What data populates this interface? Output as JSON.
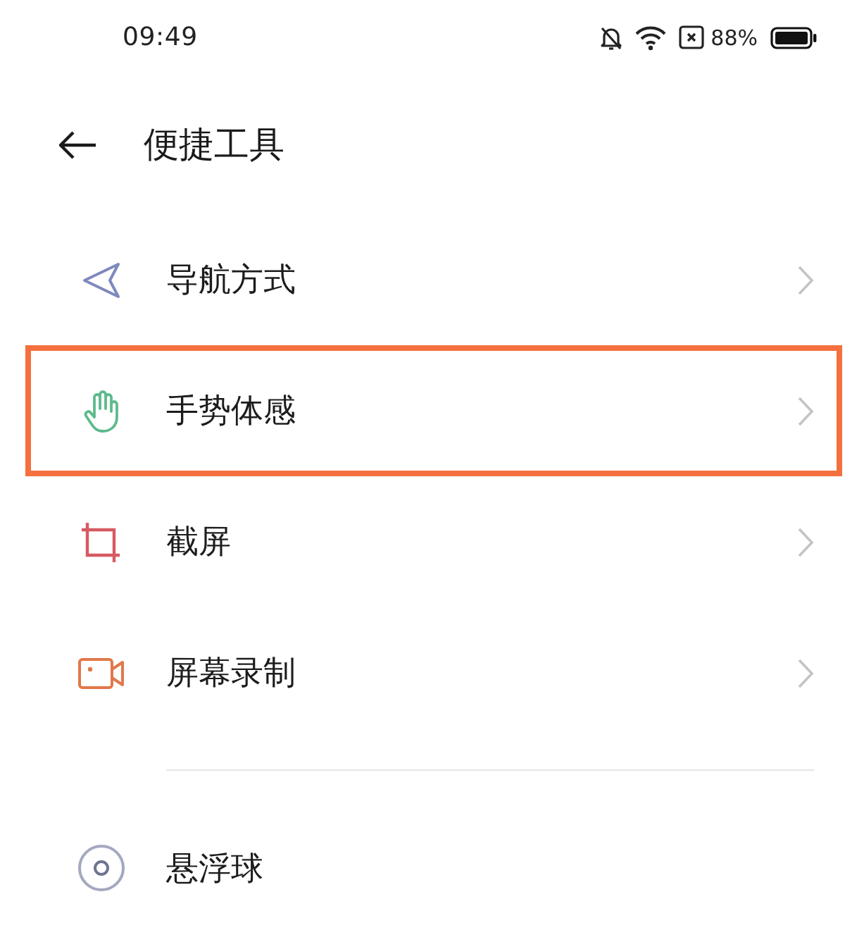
{
  "status_bar": {
    "time": "09:49",
    "battery_text": "88%"
  },
  "header": {
    "title": "便捷工具"
  },
  "items": [
    {
      "label": "导航方式",
      "chevron": true,
      "highlighted": false
    },
    {
      "label": "手势体感",
      "chevron": true,
      "highlighted": true
    },
    {
      "label": "截屏",
      "chevron": true,
      "highlighted": false
    },
    {
      "label": "屏幕录制",
      "chevron": true,
      "highlighted": false
    }
  ],
  "more_items": [
    {
      "label": "悬浮球",
      "chevron": false,
      "highlighted": false
    }
  ]
}
